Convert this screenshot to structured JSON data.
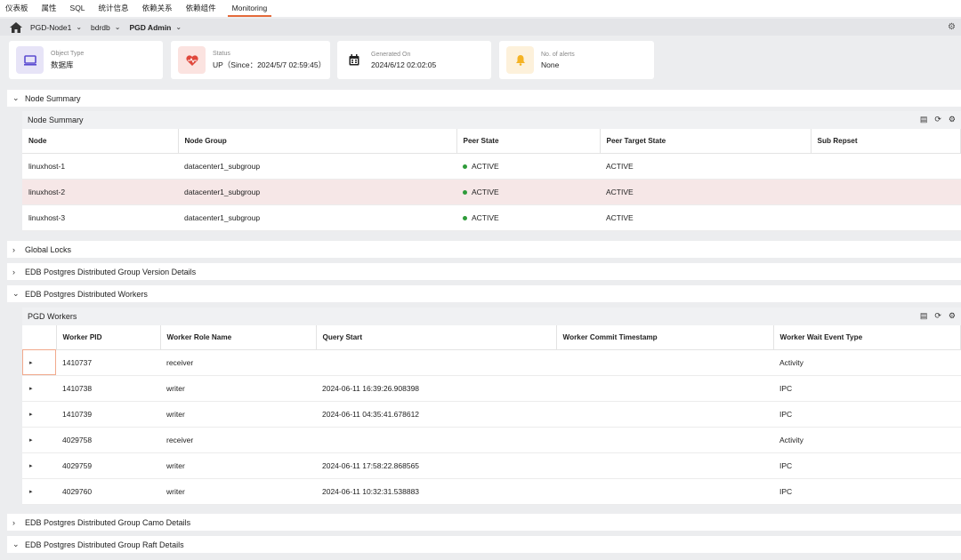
{
  "tabs": [
    {
      "label": "仪表板"
    },
    {
      "label": "属性"
    },
    {
      "label": "SQL"
    },
    {
      "label": "统计信息"
    },
    {
      "label": "依赖关系"
    },
    {
      "label": "依赖组件"
    },
    {
      "label": "Monitoring"
    }
  ],
  "breadcrumb": {
    "node": "PGD-Node1",
    "db": "bdrdb",
    "user": "PGD Admin"
  },
  "cards": {
    "object_type": {
      "label": "Object Type",
      "value": "数据库"
    },
    "status": {
      "label": "Status",
      "value": "UP（Since：2024/5/7 02:59:45）"
    },
    "generated": {
      "label": "Generated On",
      "value": "2024/6/12 02:02:05"
    },
    "alerts": {
      "label": "No. of alerts",
      "value": "None"
    }
  },
  "sections": {
    "node_summary": "Node Summary",
    "global_locks": "Global Locks",
    "version_details": "EDB Postgres Distributed Group Version Details",
    "workers": "EDB Postgres Distributed Workers",
    "camo": "EDB Postgres Distributed Group Camo Details",
    "raft": "EDB Postgres Distributed Group Raft Details"
  },
  "node_summary_panel": {
    "title": "Node Summary",
    "columns": [
      "Node",
      "Node Group",
      "Peer State",
      "Peer Target State",
      "Sub Repset"
    ],
    "rows": [
      {
        "node": "linuxhost-1",
        "group": "datacenter1_subgroup",
        "peer_state": "ACTIVE",
        "target": "ACTIVE",
        "repset": ""
      },
      {
        "node": "linuxhost-2",
        "group": "datacenter1_subgroup",
        "peer_state": "ACTIVE",
        "target": "ACTIVE",
        "repset": ""
      },
      {
        "node": "linuxhost-3",
        "group": "datacenter1_subgroup",
        "peer_state": "ACTIVE",
        "target": "ACTIVE",
        "repset": ""
      }
    ]
  },
  "workers_panel": {
    "title": "PGD Workers",
    "columns": [
      "Worker PID",
      "Worker Role Name",
      "Query Start",
      "Worker Commit Timestamp",
      "Worker Wait Event Type"
    ],
    "rows": [
      {
        "pid": "1410737",
        "role": "receiver",
        "query_start": "",
        "commit_ts": "",
        "wait": "Activity"
      },
      {
        "pid": "1410738",
        "role": "writer",
        "query_start": "2024-06-11 16:39:26.908398",
        "commit_ts": "",
        "wait": "IPC"
      },
      {
        "pid": "1410739",
        "role": "writer",
        "query_start": "2024-06-11 04:35:41.678612",
        "commit_ts": "",
        "wait": "IPC"
      },
      {
        "pid": "4029758",
        "role": "receiver",
        "query_start": "",
        "commit_ts": "",
        "wait": "Activity"
      },
      {
        "pid": "4029759",
        "role": "writer",
        "query_start": "2024-06-11 17:58:22.868565",
        "commit_ts": "",
        "wait": "IPC"
      },
      {
        "pid": "4029760",
        "role": "writer",
        "query_start": "2024-06-11 10:32:31.538883",
        "commit_ts": "",
        "wait": "IPC"
      }
    ]
  },
  "colors": {
    "accent": "#e56a3b",
    "status_green": "#2e9b3a",
    "highlight_row": "#f6e7e7"
  }
}
